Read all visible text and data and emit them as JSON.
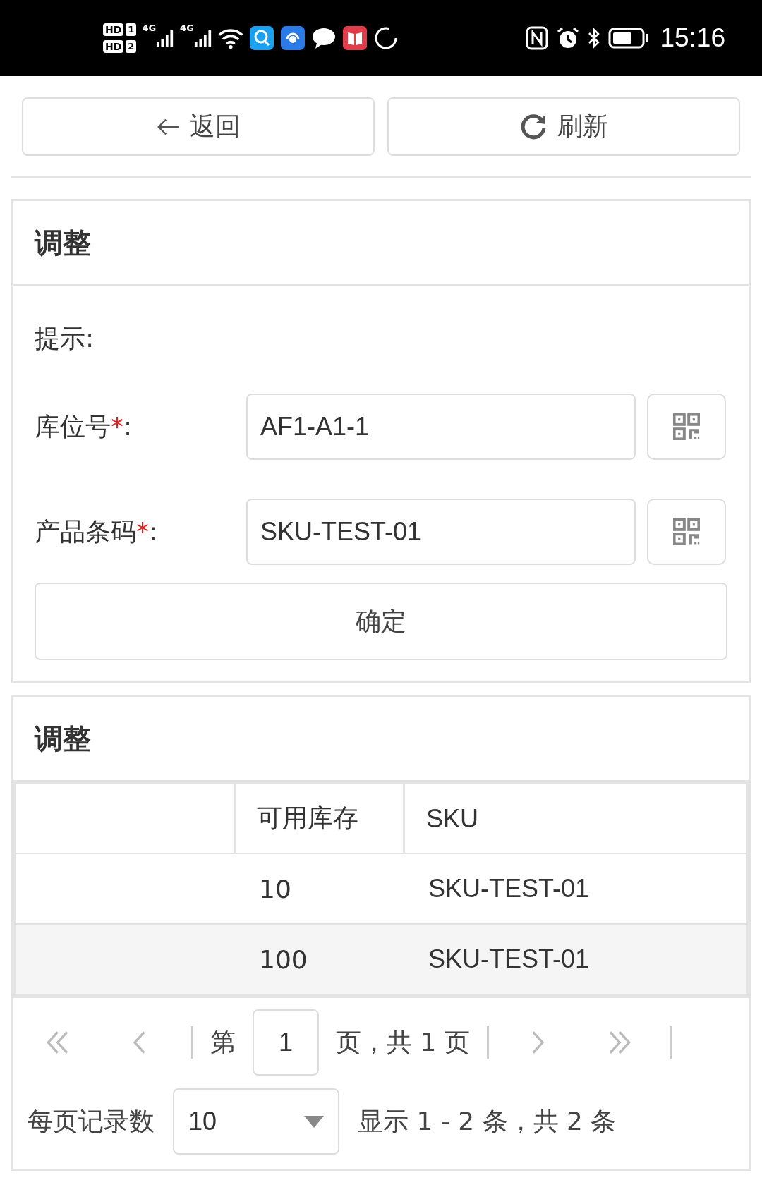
{
  "status_bar": {
    "sims": [
      {
        "label": "HD",
        "slot": "1"
      },
      {
        "label": "HD",
        "slot": "2"
      }
    ],
    "networks": [
      "4G",
      "4G"
    ],
    "time": "15:16"
  },
  "toolbar": {
    "back": "返回",
    "refresh": "刷新"
  },
  "form_panel": {
    "title": "调整",
    "hint": "提示:",
    "fields": [
      {
        "label": "库位号",
        "required_mark": "*",
        "colon": ":",
        "value": "AF1-A1-1"
      },
      {
        "label": "产品条码",
        "required_mark": "*",
        "colon": ":",
        "value": "SKU-TEST-01"
      }
    ],
    "submit": "确定"
  },
  "table_panel": {
    "title": "调整",
    "columns": [
      "可用库存",
      "SKU"
    ],
    "rows": [
      {
        "cells": [
          "10",
          "SKU-TEST-01"
        ]
      },
      {
        "cells": [
          "100",
          "SKU-TEST-01"
        ]
      }
    ],
    "pager": {
      "page_prefix": "第",
      "page": "1",
      "page_suffix": "页，共 1 页",
      "per_page_label": "每页记录数",
      "per_page": "10",
      "summary": "显示 1 - 2 条，共 2 条"
    }
  }
}
